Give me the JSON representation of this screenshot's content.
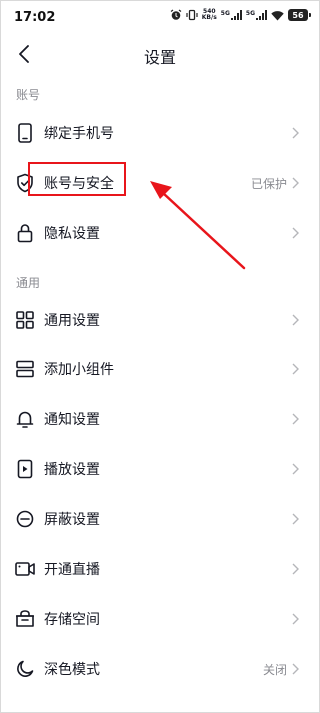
{
  "status_bar": {
    "time": "17:02",
    "net_speed_value": "540",
    "net_speed_unit": "KB/s",
    "sim1": "5G",
    "sim2": "5G",
    "battery": "56"
  },
  "header": {
    "title": "设置"
  },
  "sections": [
    {
      "label": "账号",
      "items": [
        {
          "label": "绑定手机号",
          "icon": "phone-icon"
        },
        {
          "label": "账号与安全",
          "icon": "shield-icon",
          "value": "已保护"
        },
        {
          "label": "隐私设置",
          "icon": "lock-icon"
        }
      ]
    },
    {
      "label": "通用",
      "items": [
        {
          "label": "通用设置",
          "icon": "grid-icon"
        },
        {
          "label": "添加小组件",
          "icon": "widget-icon"
        },
        {
          "label": "通知设置",
          "icon": "bell-icon"
        },
        {
          "label": "播放设置",
          "icon": "play-icon"
        },
        {
          "label": "屏蔽设置",
          "icon": "block-icon"
        },
        {
          "label": "开通直播",
          "icon": "video-icon"
        },
        {
          "label": "存储空间",
          "icon": "storage-icon"
        },
        {
          "label": "深色模式",
          "icon": "moon-icon",
          "value": "关闭"
        }
      ]
    }
  ],
  "annotation": {
    "color": "#e8151b"
  }
}
